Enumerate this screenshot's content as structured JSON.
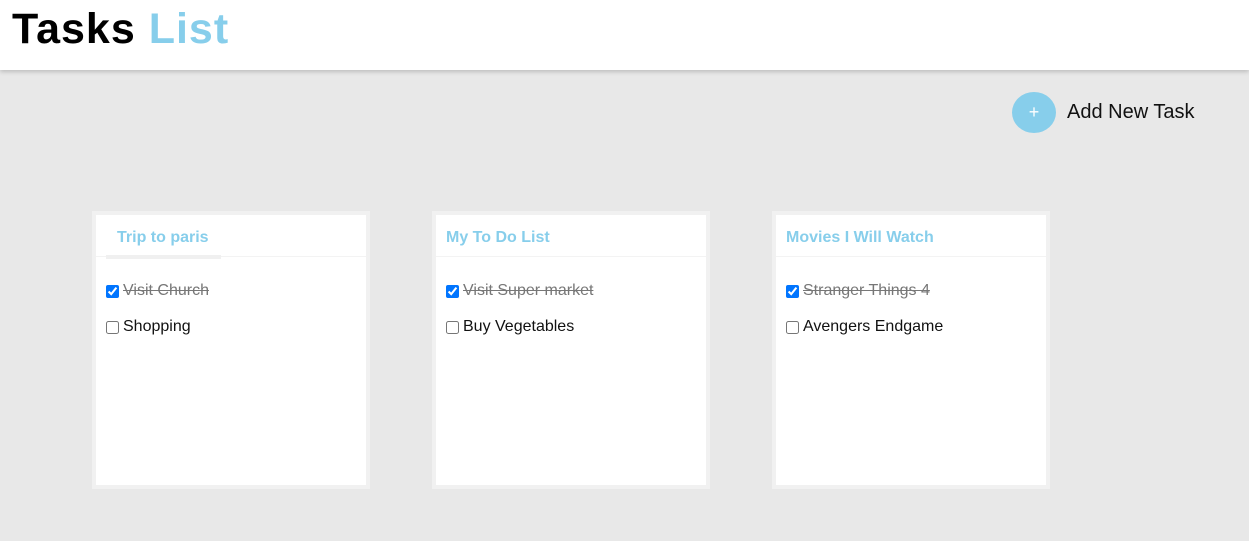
{
  "header": {
    "title_primary": "Tasks",
    "title_accent": "List"
  },
  "add_task": {
    "icon": "+",
    "label": "Add New Task"
  },
  "colors": {
    "accent": "#87ceeb",
    "background": "#e8e8e8",
    "card": "#ffffff"
  },
  "lists": [
    {
      "title": "Trip to paris",
      "tasks": [
        {
          "label": "Visit Church",
          "done": true
        },
        {
          "label": "Shopping",
          "done": false
        }
      ]
    },
    {
      "title": "My To Do List",
      "tasks": [
        {
          "label": "Visit Super market",
          "done": true
        },
        {
          "label": "Buy Vegetables",
          "done": false
        }
      ]
    },
    {
      "title": "Movies I Will Watch",
      "tasks": [
        {
          "label": "Stranger Things 4",
          "done": true
        },
        {
          "label": "Avengers Endgame",
          "done": false
        }
      ]
    }
  ]
}
